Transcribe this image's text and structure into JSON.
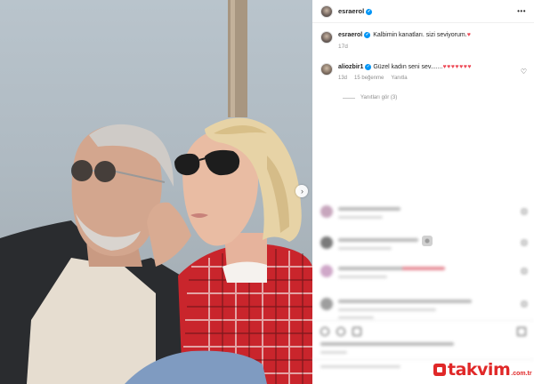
{
  "post": {
    "author": "esraerol",
    "caption_user": "esraerol",
    "caption_text": "Kalbimin kanatları. sizi seviyorum.",
    "caption_emoji": "♥",
    "caption_time": "17d",
    "more_icon": "•••"
  },
  "comment": {
    "user": "aliozbir1",
    "text": "Güzel kadın seni sev.......",
    "hearts": "♥♥♥♥♥♥♥",
    "time": "13d",
    "likes": "15 beğenme",
    "reply_label": "Yanıtla",
    "view_replies": "Yanıtları gör (3)",
    "like_icon": "♡"
  },
  "watermark": {
    "brand": "takvim",
    "tld": ".com.tr"
  },
  "photo": {
    "next_icon": "›"
  },
  "colors": {
    "verified": "#0095f6",
    "heart": "#ed4956",
    "brand": "#e02828"
  }
}
